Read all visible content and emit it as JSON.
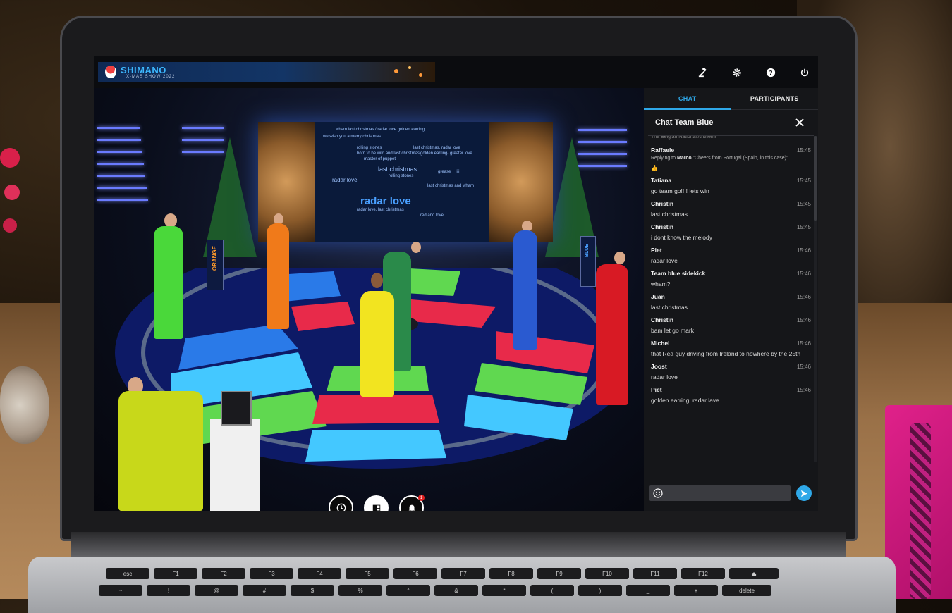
{
  "banner": {
    "brand": "SHIMANO",
    "subtitle": "X-MAS SHOW 2022"
  },
  "toolbar": {
    "icons": [
      "gavel-icon",
      "gear-icon",
      "help-icon",
      "power-icon"
    ]
  },
  "stage": {
    "screen_words": [
      "wham last christmas / radar love golden earring",
      "we wish you a merry christmas",
      "rolling stones",
      "born to be wild and last christmas",
      "master of puppet",
      "last christmas, radar love",
      "golden earring- greater love",
      "last christmas",
      "radar love",
      "grease + lili",
      "rolling stones",
      "last christmas and wham",
      "radar love, last christmas",
      "red and love"
    ],
    "screen_headline": "radar love",
    "podium_left": "ORANGE",
    "podium_right": "BLUE",
    "controls": [
      {
        "name": "clock-icon",
        "active": false
      },
      {
        "name": "layout-icon",
        "active": true
      },
      {
        "name": "bell-icon",
        "active": false,
        "badge": "1"
      }
    ]
  },
  "panel": {
    "tabs": [
      {
        "label": "CHAT",
        "active": true
      },
      {
        "label": "PARTICIPANTS",
        "active": false
      }
    ],
    "chat_title": "Chat Team Blue",
    "truncated_line": "The Belgian National Anthem!",
    "messages": [
      {
        "name": "Raffaele",
        "time": "15:45",
        "reply_prefix": "Replying to",
        "reply_to": "Marco",
        "reply_quote": "\"Cheers from Portugal (Spain, in this case)\"",
        "text": "👍"
      },
      {
        "name": "Tatiana",
        "time": "15:45",
        "text": "go team go!!!! lets win"
      },
      {
        "name": "Christin",
        "time": "15:45",
        "text": "last christmas"
      },
      {
        "name": "Christin",
        "time": "15:45",
        "text": "i dont know the melody"
      },
      {
        "name": "Piet",
        "time": "15:46",
        "text": "radar love"
      },
      {
        "name": "Team blue sidekick",
        "time": "15:46",
        "text": "wham?"
      },
      {
        "name": "Juan",
        "time": "15:46",
        "text": "last christmas"
      },
      {
        "name": "Christin",
        "time": "15:46",
        "text": "bam let go mark"
      },
      {
        "name": "Michel",
        "time": "15:46",
        "text": "that Rea guy driving from Ireland to nowhere by the 25th"
      },
      {
        "name": "Joost",
        "time": "15:46",
        "text": "radar love"
      },
      {
        "name": "Piet",
        "time": "15:46",
        "text": "golden earring, radar lave"
      }
    ],
    "input_placeholder": ""
  },
  "keyboard": {
    "row1": [
      "esc",
      "F1",
      "F2",
      "F3",
      "F4",
      "F5",
      "F6",
      "F7",
      "F8",
      "F9",
      "F10",
      "F11",
      "F12",
      "⏏"
    ],
    "row2": [
      "~",
      "!",
      "@",
      "#",
      "$",
      "%",
      "^",
      "&",
      "*",
      "(",
      ")",
      "_",
      "+",
      "delete"
    ]
  },
  "colors": {
    "accent": "#2fa8e8",
    "panel_bg": "#151619",
    "topbar_bg": "#0b0c0f"
  }
}
